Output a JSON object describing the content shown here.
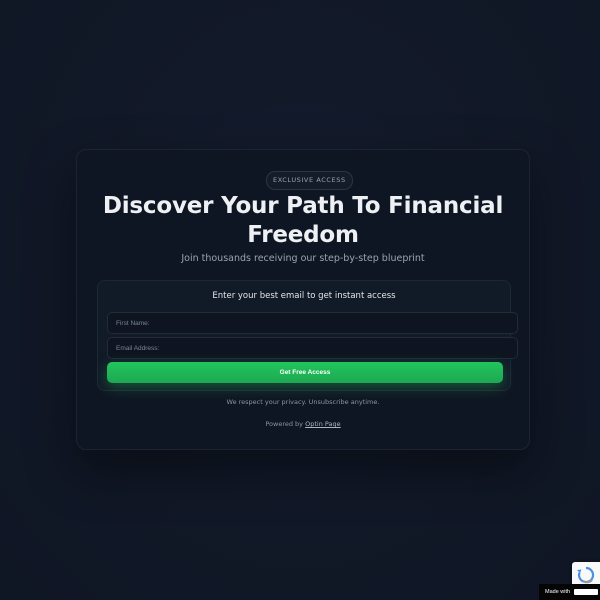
{
  "card": {
    "badge": "EXCLUSIVE ACCESS",
    "title": "Discover Your Path To Financial Freedom",
    "subtitle": "Join thousands receiving our step-by-step blueprint"
  },
  "form": {
    "heading": "Enter your best email to get instant access",
    "first_name": {
      "value": "",
      "placeholder": "First Name:"
    },
    "email": {
      "value": "",
      "placeholder": "Email Address:"
    },
    "submit_label": "Get Free Access"
  },
  "footer": {
    "privacy": "We respect your privacy. Unsubscribe anytime.",
    "powered_prefix": "Powered by",
    "powered_link": "Optin Page"
  },
  "made_with": {
    "label": "Made with"
  },
  "colors": {
    "background": "#111827",
    "card": "#0f1623",
    "accent": "#22c55e"
  },
  "icons": {
    "recaptcha": "recaptcha-icon"
  }
}
